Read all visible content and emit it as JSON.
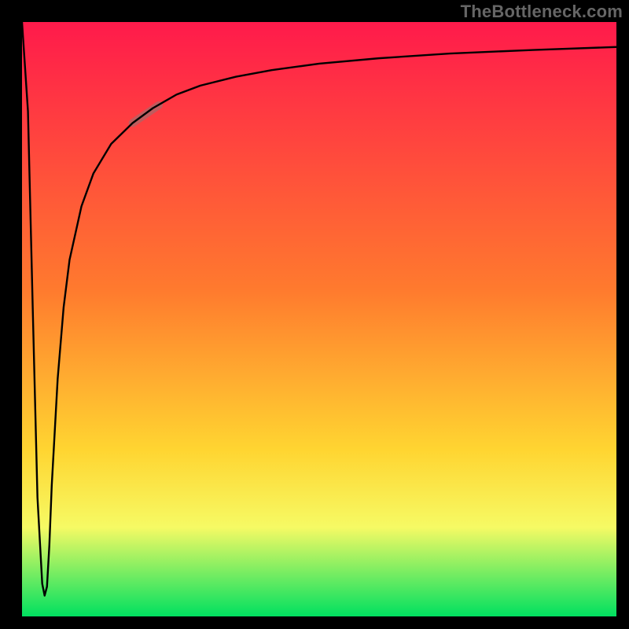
{
  "watermark": {
    "text": "TheBottleneck.com"
  },
  "chart_data": {
    "type": "line",
    "title": "",
    "xlabel": "",
    "ylabel": "",
    "xlim": [
      0,
      100
    ],
    "ylim": [
      0,
      100
    ],
    "grid": false,
    "background_gradient": {
      "stops": [
        "#ff1a4b",
        "#ff7a2e",
        "#ffd531",
        "#f6fa64",
        "#00e060"
      ],
      "offsets": [
        0,
        0.45,
        0.72,
        0.85,
        1.0
      ]
    },
    "series": [
      {
        "name": "curve",
        "x": [
          0.0,
          1.0,
          1.8,
          2.6,
          3.4,
          3.8,
          4.2,
          4.6,
          5.0,
          6.0,
          7.0,
          8.0,
          10.0,
          12.0,
          15.0,
          18.6,
          22.0,
          26.0,
          30.0,
          36.0,
          42.0,
          50.0,
          60.0,
          72.0,
          86.0,
          100.0
        ],
        "y": [
          100.0,
          85.0,
          52.0,
          20.0,
          5.5,
          3.5,
          5.0,
          12.0,
          22.0,
          40.0,
          52.0,
          60.0,
          69.0,
          74.5,
          79.5,
          83.0,
          85.5,
          87.8,
          89.3,
          90.8,
          91.9,
          93.0,
          93.9,
          94.7,
          95.3,
          95.8
        ]
      }
    ],
    "highlight_segment": {
      "x": [
        18.6,
        23.0
      ],
      "y": [
        83.0,
        86.0
      ]
    }
  }
}
